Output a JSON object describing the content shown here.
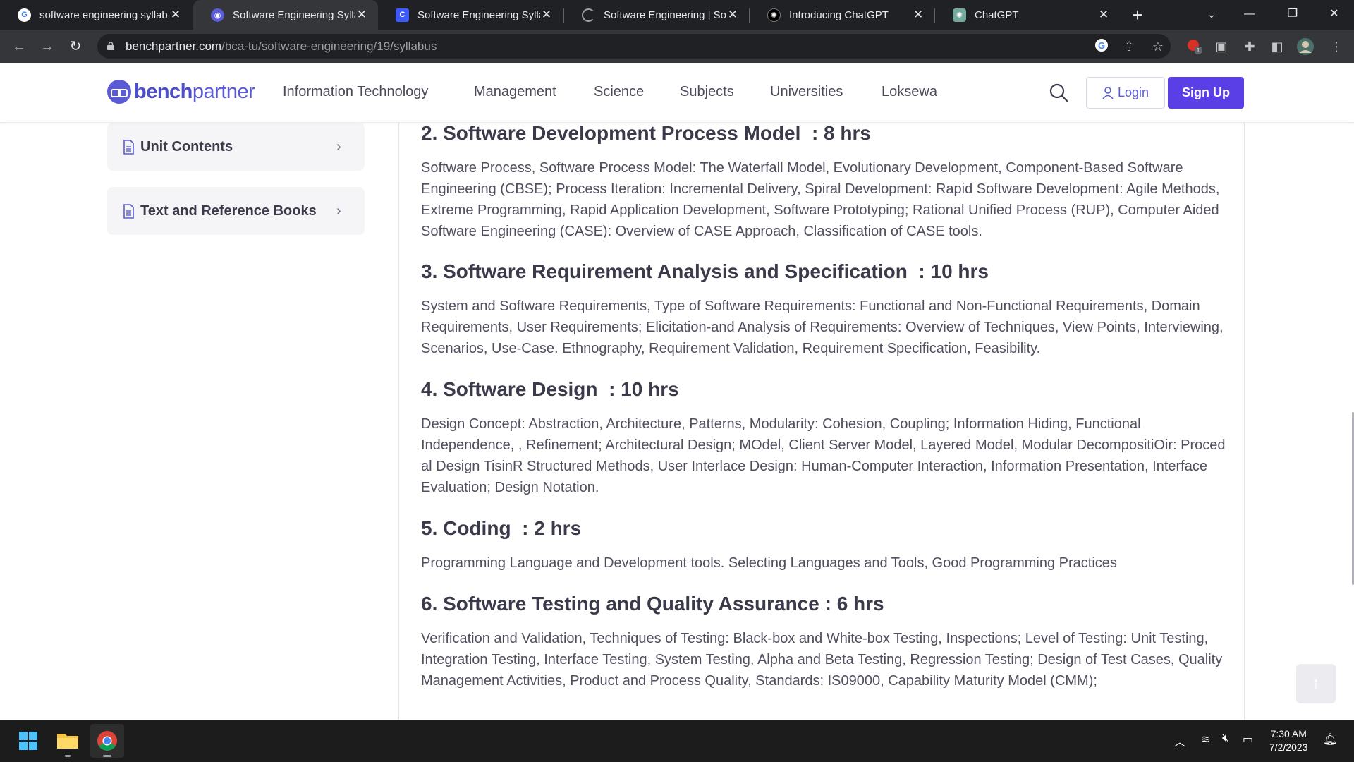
{
  "browser": {
    "tabs": [
      {
        "title": "software engineering syllab",
        "favicon": "google-icon",
        "active": false
      },
      {
        "title": "Software Engineering Syllab",
        "favicon": "benchpartner-icon",
        "active": true
      },
      {
        "title": "Software Engineering Syllab",
        "favicon": "c-icon",
        "active": false
      },
      {
        "title": "Software Engineering | Soft",
        "favicon": "loading-icon",
        "active": false
      },
      {
        "title": "Introducing ChatGPT",
        "favicon": "openai-icon",
        "active": false
      },
      {
        "title": "ChatGPT",
        "favicon": "chatgpt-icon",
        "active": false
      }
    ],
    "url_host": "benchpartner.com",
    "url_path": "/bca-tu/software-engineering/19/syllabus",
    "extension_badge": "1"
  },
  "site": {
    "logo_bold": "bench",
    "logo_light": "partner",
    "nav": [
      "Information Technology",
      "Management",
      "Science",
      "Subjects",
      "Universities",
      "Loksewa"
    ],
    "login_label": "Login",
    "signup_label": "Sign Up",
    "accent": "#5b3fe6"
  },
  "sidebar": {
    "items": [
      {
        "label": "Unit Contents"
      },
      {
        "label": "Text and Reference Books"
      }
    ]
  },
  "units": [
    {
      "title": "2. Software Development Process Model",
      "hours": ": 8 hrs",
      "body": "Software Process, Software Process Model: The Waterfall Model, Evolutionary Development, Component-Based Software Engineering (CBSE); Process Iteration: Incremental Delivery, Spiral Development: Rapid Software Development: Agile Methods, Extreme Programming, Rapid Application Development, Software Prototyping; Rational Unified Process (RUP), Computer Aided Software Engineering (CASE): Overview of CASE Approach, Classification of CASE tools."
    },
    {
      "title": "3. Software Requirement Analysis and Specification",
      "hours": ": 10 hrs",
      "body": "System and Software Requirements, Type of Software Requirements: Functional and Non-Functional Requirements, Domain Requirements, User Requirements; Elicitation-and Analysis of Requirements: Overview of Techniques, View Points, Interviewing, Scenarios, Use-Case. Ethnography, Requirement Validation, Requirement Specification, Feasibility."
    },
    {
      "title": "4. Software Design",
      "hours": ": 10 hrs",
      "body": "Design Concept: Abstraction, Architecture, Patterns, Modularity: Cohesion, Coupling; Information Hiding, Functional Independence, , Refinement; Architectural Design; MOdel, Client Server Model, Layered Model, Modular DecompositiOir: Proced al Design TisinR Structured Methods, User Interlace Design: Human-Computer Interaction, Information Presentation, Interface Evaluation; Design Notation."
    },
    {
      "title": "5. Coding",
      "hours": ": 2 hrs",
      "body": "Programming Language and Development tools. Selecting Languages and Tools, Good Programming Practices"
    },
    {
      "title": "6. Software Testing and Quality Assurance",
      "hours": ": 6 hrs",
      "body": "Verification and Validation, Techniques of Testing: Black-box and White-box Testing, Inspections; Level of Testing: Unit Testing, Integration Testing, Interface Testing, System Testing, Alpha and Beta Testing, Regression Testing; Design of Test Cases, Quality Management Activities, Product and Process Quality, Standards: IS09000, Capability Maturity Model (CMM);"
    }
  ],
  "taskbar": {
    "time": "7:30 AM",
    "date": "7/2/2023"
  }
}
